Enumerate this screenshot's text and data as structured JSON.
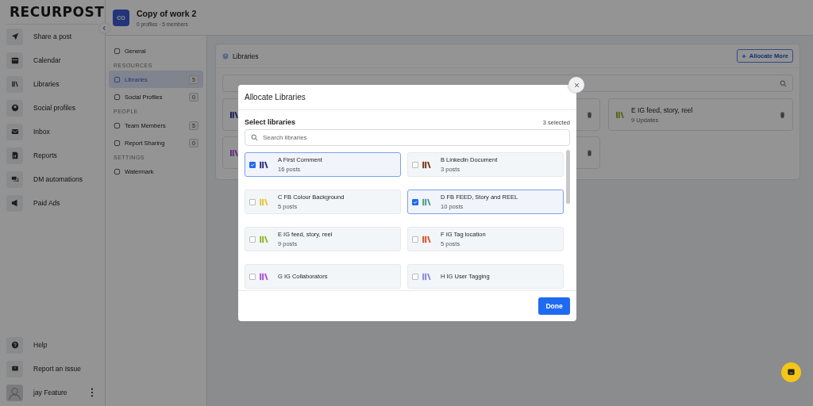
{
  "logo": "RECURPOST",
  "nav": [
    {
      "label": "Share a post"
    },
    {
      "label": "Calendar"
    },
    {
      "label": "Libraries"
    },
    {
      "label": "Social profiles"
    },
    {
      "label": "Inbox"
    },
    {
      "label": "Reports"
    },
    {
      "label": "DM automations"
    },
    {
      "label": "Paid Ads"
    }
  ],
  "nav_bottom": [
    {
      "label": "Help"
    },
    {
      "label": "Report an Issue"
    }
  ],
  "user": {
    "name": "jay Feature"
  },
  "workspace": {
    "initials": "CO",
    "title": "Copy of work 2",
    "subtitle": "0 profiles · 5 members"
  },
  "settings_menu": [
    {
      "kind": "item",
      "label": "General",
      "selected": false
    },
    {
      "kind": "heading",
      "label": "RESOURCES"
    },
    {
      "kind": "item",
      "label": "Libraries",
      "count": "5",
      "selected": true
    },
    {
      "kind": "item",
      "label": "Social Profiles",
      "count": "0",
      "selected": false
    },
    {
      "kind": "heading",
      "label": "PEOPLE"
    },
    {
      "kind": "item",
      "label": "Team Members",
      "count": "5",
      "selected": false
    },
    {
      "kind": "item",
      "label": "Report Sharing",
      "count": "0",
      "selected": false
    },
    {
      "kind": "heading",
      "label": "SETTINGS"
    },
    {
      "kind": "item",
      "label": "Watermark",
      "selected": false
    }
  ],
  "panel": {
    "title": "Libraries",
    "button": "Allocate More"
  },
  "library_cards": [
    {
      "kind": "edge",
      "color": "#191953"
    },
    {
      "kind": "covered"
    },
    {
      "kind": "full",
      "name": "E IG feed, story, reel",
      "meta": "9 Updates",
      "color": "#536618"
    },
    {
      "kind": "edge",
      "color": "#5e2e7c"
    },
    {
      "kind": "covered"
    }
  ],
  "modal": {
    "title": "Allocate Libraries",
    "section": "Select libraries",
    "count": "3 selected",
    "search_placeholder": "Search libraries",
    "done": "Done",
    "libraries": [
      {
        "name": "A First Comment",
        "meta": "16 posts",
        "color": "#2b2b8f",
        "selected": true
      },
      {
        "name": "B Linkedin Document",
        "meta": "3 posts",
        "color": "#7a3518",
        "selected": false
      },
      {
        "name": "C FB Colour Background",
        "meta": "5 posts",
        "color": "#e8c53a",
        "selected": false
      },
      {
        "name": "D FB FEED, Story and REEL",
        "meta": "10 posts",
        "color": "#4f9a8f",
        "selected": true
      },
      {
        "name": "E IG feed, story, reel",
        "meta": "9 posts",
        "color": "#94b52a",
        "selected": false
      },
      {
        "name": "F IG Tag location",
        "meta": "5 posts",
        "color": "#e0502a",
        "selected": false
      },
      {
        "name": "G IG Collaborators",
        "color": "#b04fd8",
        "selected": false
      },
      {
        "name": "H IG User Tagging",
        "color": "#8a8ae0",
        "selected": false
      }
    ]
  }
}
